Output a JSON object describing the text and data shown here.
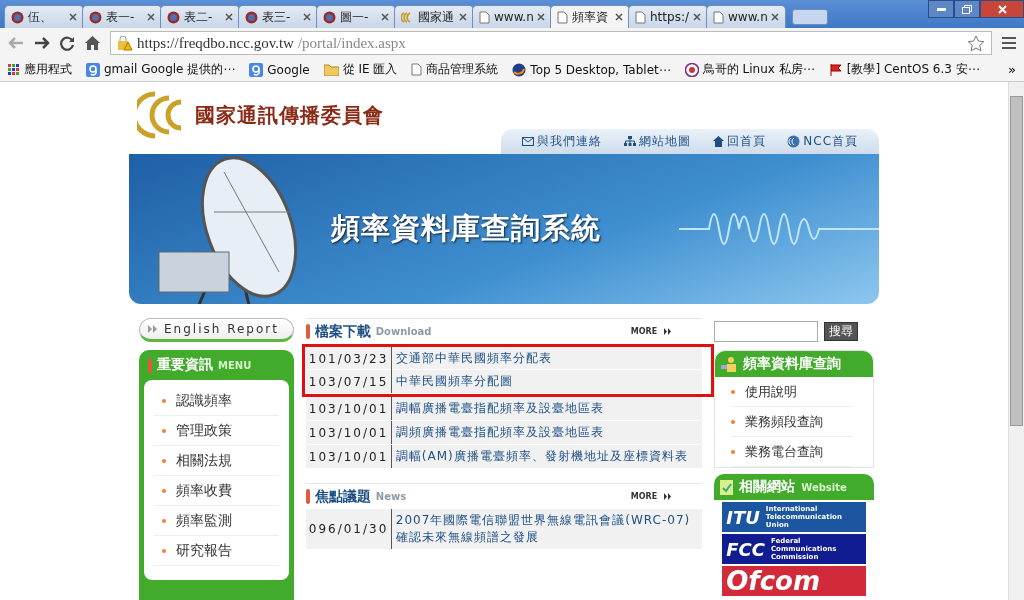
{
  "browser": {
    "tabs": [
      {
        "label": "伍、",
        "kind": "crest",
        "selected": false
      },
      {
        "label": "表一-",
        "kind": "crest",
        "selected": false
      },
      {
        "label": "表二-",
        "kind": "crest",
        "selected": false
      },
      {
        "label": "表三-",
        "kind": "crest",
        "selected": false
      },
      {
        "label": "圖一-",
        "kind": "crest",
        "selected": false
      },
      {
        "label": "國家通",
        "kind": "ncc",
        "selected": false
      },
      {
        "label": "www.n",
        "kind": "page",
        "selected": false
      },
      {
        "label": "頻率資",
        "kind": "page",
        "selected": true
      },
      {
        "label": "https:/",
        "kind": "page",
        "selected": false
      },
      {
        "label": "www.n",
        "kind": "page",
        "selected": false
      }
    ],
    "url_host": "https://freqdbo.ncc.gov.tw",
    "url_path": "/portal/index.aspx",
    "bookmarks": [
      {
        "label": "應用程式",
        "kind": "apps"
      },
      {
        "label": "gmail Google 提供的⋯",
        "kind": "google"
      },
      {
        "label": "Google",
        "kind": "google"
      },
      {
        "label": "從 IE 匯入",
        "kind": "folder"
      },
      {
        "label": "商品管理系統",
        "kind": "page"
      },
      {
        "label": "Top 5 Desktop, Tablet⋯",
        "kind": "globe"
      },
      {
        "label": "鳥哥的 Linux 私房⋯",
        "kind": "crest"
      },
      {
        "label": "[教學] CentOS 6.3 安⋯",
        "kind": "flag"
      }
    ],
    "bookmarks_overflow": "»"
  },
  "site": {
    "org_name": "國家通訊傳播委員會",
    "nav": [
      {
        "label": "與我們連絡",
        "kind": "mail"
      },
      {
        "label": "網站地圖",
        "kind": "sitemap"
      },
      {
        "label": "回首頁",
        "kind": "home"
      },
      {
        "label": "NCC首頁",
        "kind": "ncc"
      }
    ],
    "banner_title": "頻率資料庫查詢系統",
    "english_report": "English Report",
    "menu": {
      "title": "重要資訊",
      "subtitle": "MENU",
      "items": [
        "認識頻率",
        "管理政策",
        "相關法規",
        "頻率收費",
        "頻率監測",
        "研究報告"
      ]
    },
    "downloads": {
      "title": "檔案下載",
      "subtitle": "Download",
      "more": "MORE",
      "rows": [
        {
          "date": "101/03/23",
          "title": "交通部中華民國頻率分配表",
          "highlighted": true
        },
        {
          "date": "103/07/15",
          "title": "中華民國頻率分配圖",
          "highlighted": true
        },
        {
          "date": "103/10/01",
          "title": "調幅廣播電臺指配頻率及設臺地區表",
          "highlighted": false
        },
        {
          "date": "103/10/01",
          "title": "調頻廣播電臺指配頻率及設臺地區表",
          "highlighted": false
        },
        {
          "date": "103/10/01",
          "title": "調幅(AM)廣播電臺頻率、發射機地址及座標資料表",
          "highlighted": false
        }
      ]
    },
    "news": {
      "title": "焦點議題",
      "subtitle": "News",
      "more": "MORE",
      "rows": [
        {
          "date": "096/01/30",
          "title": "2007年國際電信聯盟世界無線電訊會議(WRC-07)確認未來無線頻譜之發展",
          "highlighted": false
        }
      ]
    },
    "search_button": "搜尋",
    "query": {
      "title": "頻率資料庫查詢",
      "items": [
        "使用說明",
        "業務頻段查詢",
        "業務電台查詢"
      ]
    },
    "links": {
      "title": "相關網站",
      "subtitle": "Website",
      "logos": [
        {
          "kind": "itu",
          "mark": "ITU",
          "lines": [
            "International",
            "Telecommunication",
            "Union"
          ]
        },
        {
          "kind": "fcc",
          "mark": "FCC",
          "lines": [
            "Federal",
            "Communications",
            "Commission"
          ]
        },
        {
          "kind": "ofcom",
          "mark": "Ofcom"
        }
      ]
    }
  }
}
